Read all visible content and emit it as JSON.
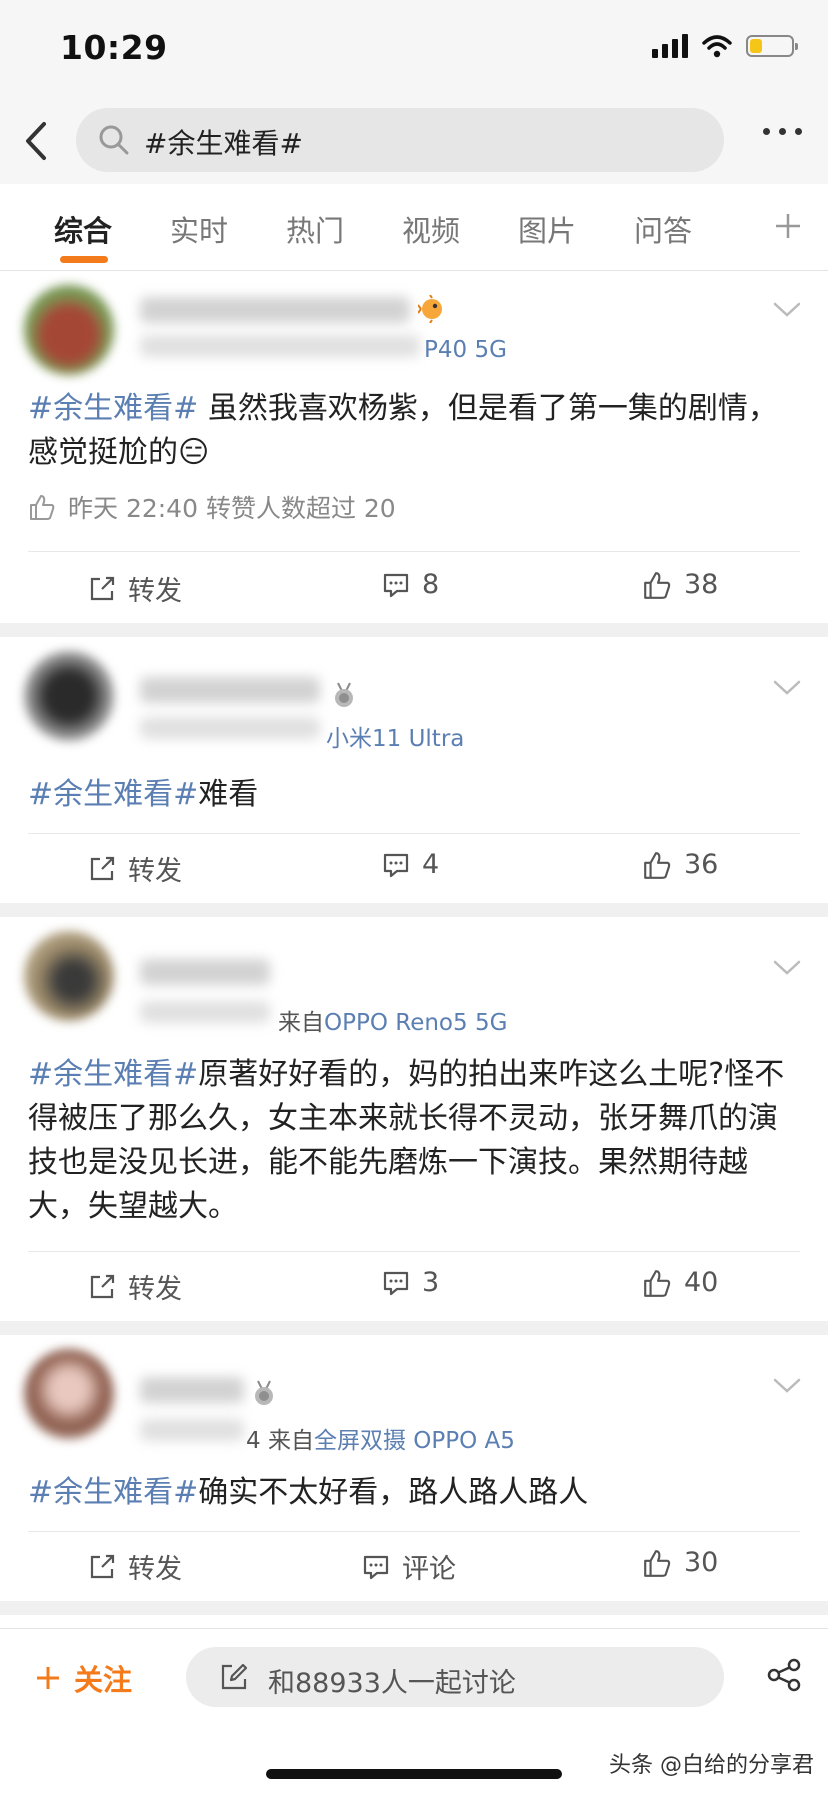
{
  "status_bar": {
    "time": "10:29",
    "battery_level": 0.3
  },
  "search": {
    "query": "#余生难看#"
  },
  "tabs": [
    {
      "label": "综合",
      "active": true
    },
    {
      "label": "实时"
    },
    {
      "label": "热门"
    },
    {
      "label": "视频"
    },
    {
      "label": "图片"
    },
    {
      "label": "问答"
    }
  ],
  "posts": [
    {
      "device": "P40 5G",
      "tag": "#余生难看#",
      "text": " 虽然我喜欢杨紫，但是看了第一集的剧情，感觉挺尬的",
      "emoji": "😑",
      "info": "昨天 22:40 转赞人数超过 20",
      "repost_label": "转发",
      "comments": "8",
      "likes": "38"
    },
    {
      "device": "小米11 Ultra",
      "tag": "#余生难看#",
      "text": "难看",
      "repost_label": "转发",
      "comments": "4",
      "likes": "36"
    },
    {
      "device_prefix": "来自",
      "device": "OPPO Reno5 5G",
      "tag": "#余生难看#",
      "text": "原著好好看的，妈的拍出来咋这么土呢?怪不得被压了那么久，女主本来就长得不灵动，张牙舞爪的演技也是没见长进，能不能先磨炼一下演技。果然期待越大，失望越大。",
      "repost_label": "转发",
      "comments": "3",
      "likes": "40"
    },
    {
      "time_fragment": "4",
      "device_prefix": "来自",
      "device": "全屏双摄 OPPO A5",
      "tag": "#余生难看#",
      "text": "确实不太好看，路人路人路人",
      "repost_label": "转发",
      "comments": "评论",
      "likes": "30"
    }
  ],
  "bottom_bar": {
    "follow_label": "关注",
    "discuss_placeholder": "和88933人一起讨论",
    "watermark": "头条 @白给的分享君"
  },
  "colors": {
    "accent": "#f47b1b",
    "link": "#5b7fb2"
  }
}
